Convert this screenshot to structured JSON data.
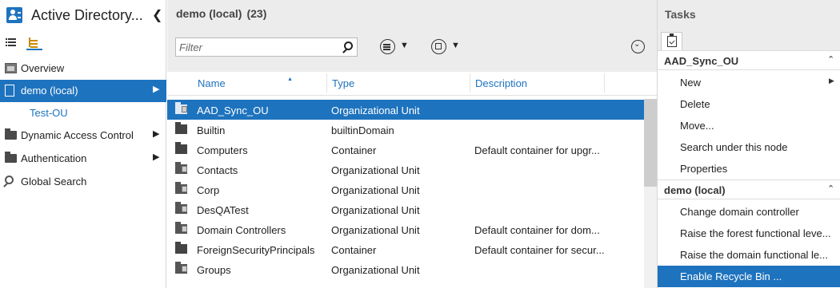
{
  "nav": {
    "title": "Active Directory...",
    "items": [
      {
        "label": "Overview"
      },
      {
        "label": "demo (local)"
      },
      {
        "label": "Test-OU"
      },
      {
        "label": "Dynamic Access Control"
      },
      {
        "label": "Authentication"
      },
      {
        "label": "Global Search"
      }
    ]
  },
  "main": {
    "title": "demo (local)",
    "count": "(23)",
    "filter_placeholder": "Filter",
    "columns": {
      "name": "Name",
      "type": "Type",
      "description": "Description"
    },
    "rows": [
      {
        "name": "AAD_Sync_OU",
        "type": "Organizational Unit",
        "description": "",
        "icon": "ou-icon"
      },
      {
        "name": "Builtin",
        "type": "builtinDomain",
        "description": "",
        "icon": "container-icon"
      },
      {
        "name": "Computers",
        "type": "Container",
        "description": "Default container for upgr...",
        "icon": "container-icon"
      },
      {
        "name": "Contacts",
        "type": "Organizational Unit",
        "description": "",
        "icon": "ou-icon"
      },
      {
        "name": "Corp",
        "type": "Organizational Unit",
        "description": "",
        "icon": "ou-icon"
      },
      {
        "name": "DesQATest",
        "type": "Organizational Unit",
        "description": "",
        "icon": "ou-icon"
      },
      {
        "name": "Domain Controllers",
        "type": "Organizational Unit",
        "description": "Default container for dom...",
        "icon": "ou-icon"
      },
      {
        "name": "ForeignSecurityPrincipals",
        "type": "Container",
        "description": "Default container for secur...",
        "icon": "container-icon"
      },
      {
        "name": "Groups",
        "type": "Organizational Unit",
        "description": "",
        "icon": "ou-icon"
      }
    ]
  },
  "tasks": {
    "title": "Tasks",
    "groups": [
      {
        "label": "AAD_Sync_OU",
        "items": [
          {
            "label": "New",
            "submenu": true
          },
          {
            "label": "Delete"
          },
          {
            "label": "Move..."
          },
          {
            "label": "Search under this node"
          },
          {
            "label": "Properties"
          }
        ]
      },
      {
        "label": "demo (local)",
        "items": [
          {
            "label": "Change domain controller"
          },
          {
            "label": "Raise the forest functional leve..."
          },
          {
            "label": "Raise the domain functional le..."
          },
          {
            "label": "Enable Recycle Bin ..."
          }
        ]
      }
    ]
  },
  "colors": {
    "accent": "#1e73be",
    "header_bg": "#ececec"
  }
}
